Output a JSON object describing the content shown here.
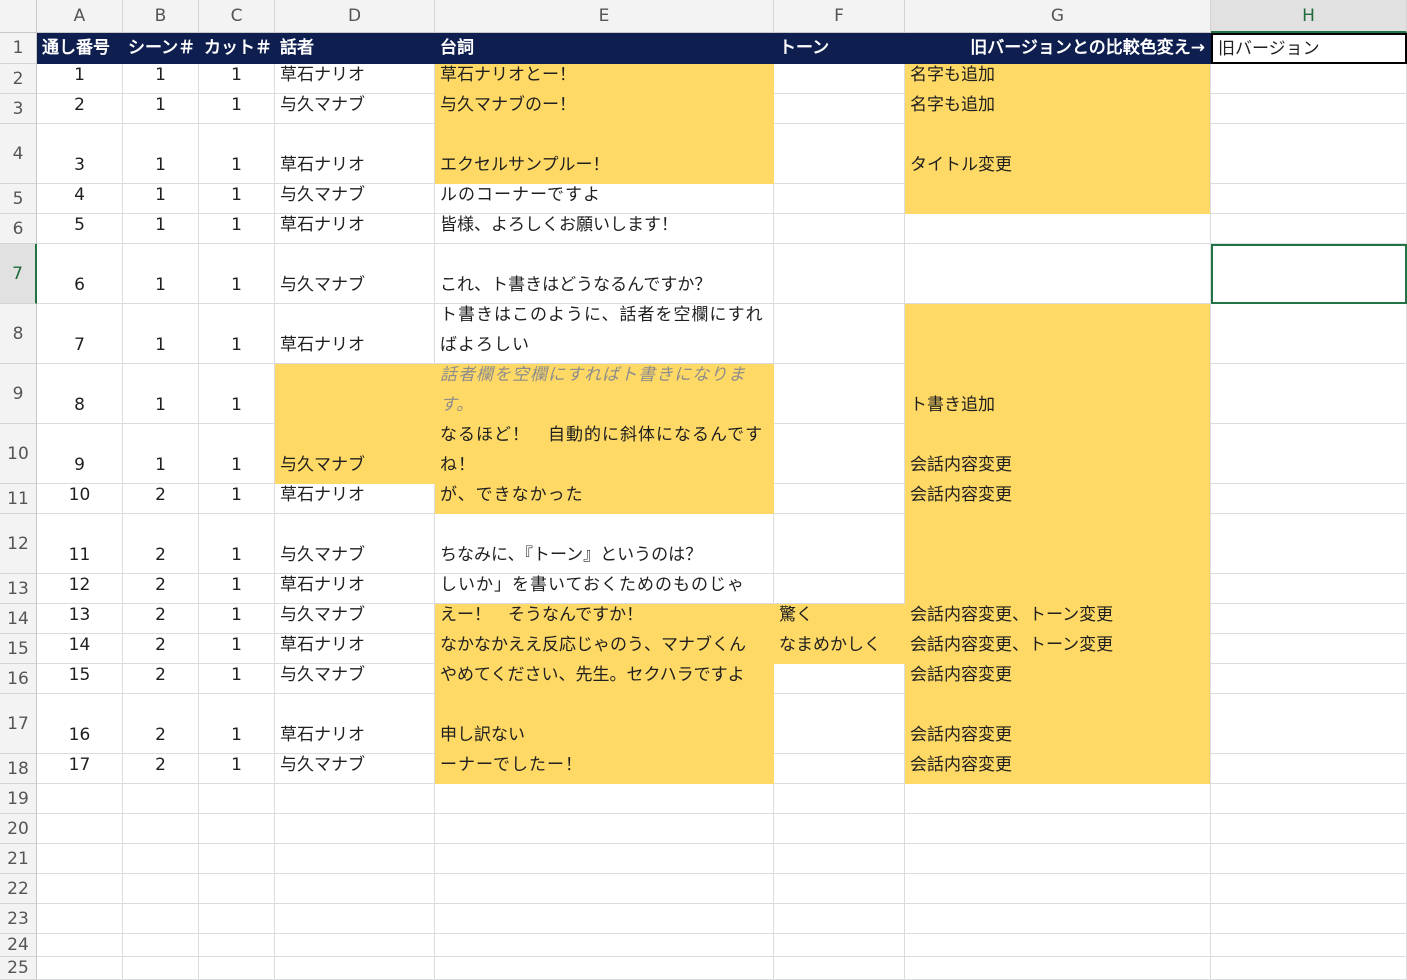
{
  "columns": [
    "A",
    "B",
    "C",
    "D",
    "E",
    "F",
    "G",
    "H"
  ],
  "row_numbers": [
    "1",
    "2",
    "3",
    "4",
    "5",
    "6",
    "7",
    "8",
    "9",
    "10",
    "11",
    "12",
    "13",
    "14",
    "15",
    "16",
    "17",
    "18",
    "19",
    "20",
    "21",
    "22",
    "23",
    "24",
    "25"
  ],
  "active_column": "H",
  "active_row": "7",
  "headers": {
    "a": "通し番号",
    "b": "シーン＃",
    "c": "カット＃",
    "d": "話者",
    "e": "台詞",
    "f": "トーン",
    "g": "旧バージョンとの比較色変え→",
    "h": "旧バージョン"
  },
  "highlight_color": "#ffd966",
  "header_color": "#0d1e4f",
  "rows": [
    {
      "a": "1",
      "b": "1",
      "c": "1",
      "d": "草石ナリオ",
      "e": "草石ナリオとー！",
      "f": "",
      "g": "名字も追加"
    },
    {
      "a": "2",
      "b": "1",
      "c": "1",
      "d": "与久マナブ",
      "e": "与久マナブのー！",
      "f": "",
      "g": "名字も追加"
    },
    {
      "a": "3",
      "b": "1",
      "c": "1",
      "d": "草石ナリオ",
      "e": "エクセルサンプルー！",
      "f": "",
      "g": "タイトル変更"
    },
    {
      "a": "4",
      "b": "1",
      "c": "1",
      "d": "与久マナブ",
      "e": "というわけで、僕たちのエクセルサンプルのコーナーですよ",
      "f": "",
      "g": ""
    },
    {
      "a": "5",
      "b": "1",
      "c": "1",
      "d": "草石ナリオ",
      "e": "皆様、よろしくお願いします！",
      "f": "",
      "g": ""
    },
    {
      "a": "6",
      "b": "1",
      "c": "1",
      "d": "与久マナブ",
      "e": "これ、ト書きはどうなるんですか？",
      "f": "",
      "g": ""
    },
    {
      "a": "7",
      "b": "1",
      "c": "1",
      "d": "草石ナリオ",
      "e": "ト書きはこのように、話者を空欄にすればよろしい",
      "f": "",
      "g": ""
    },
    {
      "a": "8",
      "b": "1",
      "c": "1",
      "d": "",
      "e": "話者欄を空欄にすればト書きになります。",
      "f": "",
      "g": "ト書き追加"
    },
    {
      "a": "9",
      "b": "1",
      "c": "1",
      "d": "与久マナブ",
      "e": "なるほど！　自動的に斜体になるんですね！",
      "f": "",
      "g": "会話内容変更"
    },
    {
      "a": "10",
      "b": "2",
      "c": "1",
      "d": "草石ナリオ",
      "e": "字下げができればもっとよかったんだが、できなかった",
      "f": "",
      "g": "会話内容変更"
    },
    {
      "a": "11",
      "b": "2",
      "c": "1",
      "d": "与久マナブ",
      "e": "ちなみに、『トーン』というのは？",
      "f": "",
      "g": ""
    },
    {
      "a": "12",
      "b": "2",
      "c": "1",
      "d": "草石ナリオ",
      "e": "音声収録の際に「どんな調子で喋ってほしいか」を書いておくためのものじゃ",
      "f": "",
      "g": ""
    },
    {
      "a": "13",
      "b": "2",
      "c": "1",
      "d": "与久マナブ",
      "e": "えー！　そうなんですか！",
      "f": "驚く",
      "g": "会話内容変更、トーン変更"
    },
    {
      "a": "14",
      "b": "2",
      "c": "1",
      "d": "草石ナリオ",
      "e": "なかなかええ反応じゃのう、マナブくん",
      "f": "なまめかしく",
      "g": "会話内容変更、トーン変更"
    },
    {
      "a": "15",
      "b": "2",
      "c": "1",
      "d": "与久マナブ",
      "e": "やめてください、先生。セクハラですよ",
      "f": "",
      "g": "会話内容変更"
    },
    {
      "a": "16",
      "b": "2",
      "c": "1",
      "d": "草石ナリオ",
      "e": "申し訳ない",
      "f": "",
      "g": "会話内容変更"
    },
    {
      "a": "17",
      "b": "2",
      "c": "1",
      "d": "与久マナブ",
      "e": "ナリオとマナブのエクセルサンプルのコーナーでしたー！",
      "f": "",
      "g": "会話内容変更"
    }
  ]
}
